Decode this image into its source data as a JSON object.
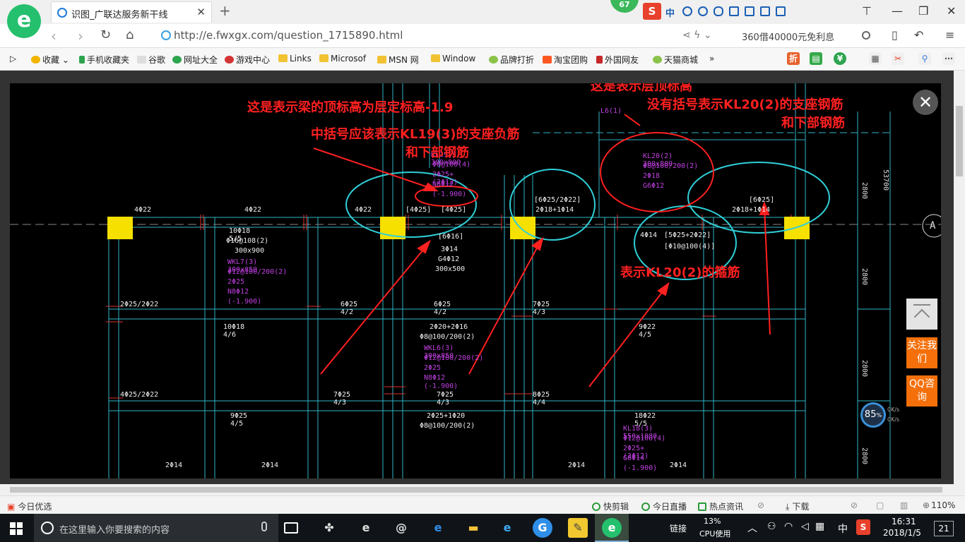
{
  "browser": {
    "tab_title": "识图_广联达服务新干线",
    "score_badge": "67",
    "url": "http://e.fwxgx.com/question_1715890.html",
    "search_text": "360借40000元免利息",
    "tray_ime": "中"
  },
  "bookmarks": [
    {
      "label": "收藏",
      "color": "#f1b400"
    },
    {
      "label": "手机收藏夹",
      "color": "#2da44e"
    },
    {
      "label": "谷歌",
      "color": "#bbbbbb"
    },
    {
      "label": "网址大全",
      "color": "#2da44e"
    },
    {
      "label": "游戏中心",
      "color": "#d33333"
    },
    {
      "label": "Links",
      "color": "#f1c232"
    },
    {
      "label": "Microsof",
      "color": "#f1c232"
    },
    {
      "label": "MSN 网",
      "color": "#f1c232"
    },
    {
      "label": "Window",
      "color": "#f1c232"
    },
    {
      "label": "品牌打折",
      "color": "#8bc34a"
    },
    {
      "label": "淘宝团购",
      "color": "#ff5722"
    },
    {
      "label": "外国网友",
      "color": "#c62828"
    },
    {
      "label": "天猫商城",
      "color": "#8bc34a"
    }
  ],
  "bookmarks_more": "»",
  "annotations": {
    "a1": "这是表示梁的顶标高为层定标高-1.9",
    "a2": "中括号应该表示KL19(3)的支座负筋",
    "a2b": "和下部钢筋",
    "a3": "这是表示层顶标高",
    "a4": "没有括号表示KL20(2)的支座钢筋",
    "a4b": "和下部钢筋",
    "a5": "表示KL20(2)的箍筋"
  },
  "cad_labels": {
    "kl20_1": "KL20(2) 300x800",
    "kl20_2": "Φ8@100/200(2)",
    "kl20_3": "2Φ18",
    "kl20_4": "G6Φ12",
    "kl19_1": "KL19(3) 300x800",
    "kl19_2": "Φ8@100(4)",
    "kl19_3": "2Φ25+(2Φ12)",
    "kl19_4": "N8Φ12",
    "kl19_5": "(-1.900)",
    "l6": "L6(1)",
    "r1": "4Φ22",
    "r2": "4Φ22",
    "r3": "4Φ22",
    "r4": "[4Φ25]",
    "r5": "[4Φ25]",
    "r6": "[6Φ25/2Φ22]",
    "r7": "2Φ18+1Φ14",
    "r8": "[6Φ25]",
    "r9": "2Φ18+1Φ14",
    "r10": "4Φ14",
    "r11": "[5Φ25+2Φ22]",
    "r12": "[Φ10@100(4)]",
    "r13": "[6Φ16]",
    "r14": "3Φ14",
    "r15": "G4Φ12",
    "r16": "300x500",
    "r17": "10Φ18 5/5",
    "r18": "Φ16@108(2)",
    "r19": "300x900",
    "w1": "WKL7(3) 300x850",
    "w2": "Φ12@100/200(2)",
    "w3": "2Φ25",
    "w4": "N8Φ12",
    "w5": "(-1.900)",
    "b1": "2Φ25/2Φ22",
    "b2": "6Φ25 4/2",
    "b3": "6Φ25 4/2",
    "b4": "7Φ25 4/3",
    "b5": "10Φ18 4/6",
    "b6": "2Φ20+2Φ16",
    "b7": "Φ8@100/200(2)",
    "b8": "9Φ22 4/5",
    "b9": "4Φ25/2Φ22",
    "b10": "7Φ25 4/3",
    "b11": "7Φ25 4/3",
    "b12": "8Φ25 4/4",
    "b13": "9Φ25 4/5",
    "b14": "2Φ25+1Φ20",
    "b15": "Φ8@100/200(2)",
    "b16": "18Φ22 5/5",
    "b17": "2Φ14",
    "b18": "2Φ14",
    "b19": "2Φ14",
    "b20": "2Φ14",
    "k1": "KL18(3) 550x1080",
    "k2": "Φ12@100(4)",
    "k3": "2Φ25+(2Φ12)",
    "k4": "G8Φ14",
    "k5": "(-1.900)",
    "w6": "WKL6(3) 300x850",
    "w7": "Φ12@100/200(2)",
    "w8": "2Φ25",
    "w9": "N8Φ12",
    "w10": "(-1.900)",
    "dim1": "2800",
    "dim2": "2800",
    "dim3": "2800",
    "dim4": "2800",
    "dim5": "53700",
    "axis": "A"
  },
  "side_buttons": {
    "follow": "关注我们",
    "qq": "QQ咨询",
    "speed": "85",
    "speed_unit": "%",
    "up_rate": "0K/s",
    "down_rate": "0K/s"
  },
  "statusbar": {
    "left": "今日优选",
    "items": [
      "快剪辑",
      "今日直播",
      "热点资讯",
      "下载"
    ],
    "zoom": "110%"
  },
  "taskbar": {
    "search_placeholder": "在这里输入你要搜索的内容",
    "link_label": "链接",
    "cpu_pct": "13%",
    "cpu_label": "CPU使用",
    "ime": "中",
    "time": "16:31",
    "date": "2018/1/5",
    "notif_count": "21"
  }
}
